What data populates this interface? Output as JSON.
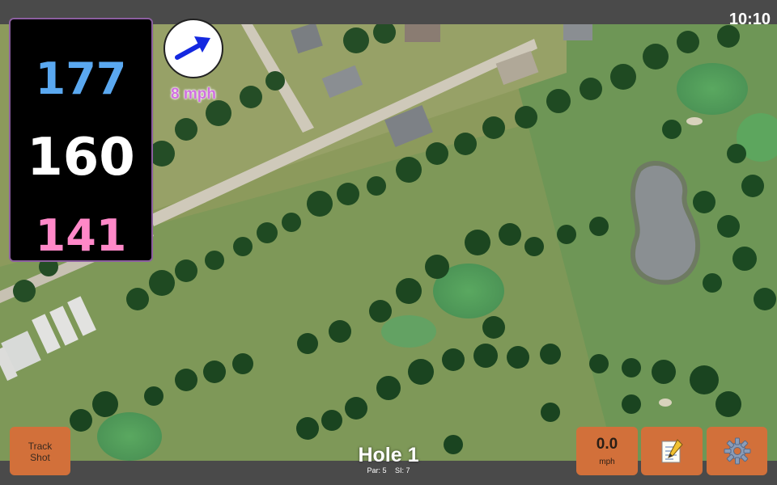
{
  "status_bar": {
    "clock": "10:10"
  },
  "distances": {
    "back": "177",
    "middle": "160",
    "front": "141"
  },
  "wind": {
    "speed_label": "8 mph",
    "direction_icon": "wind-arrow-icon"
  },
  "hole": {
    "title": "Hole 1",
    "par_label": "Par: 5",
    "si_label": "SI: 7"
  },
  "buttons": {
    "track_shot": "Track\nShot",
    "speed_value": "0.0",
    "speed_unit": "mph",
    "notes_icon": "notepad-icon",
    "settings_icon": "gear-icon"
  },
  "colors": {
    "accent_button": "#d2703a",
    "back_distance": "#5aa8f0",
    "middle_distance": "#ffffff",
    "front_distance": "#ff88c8",
    "wind_label": "#d070e0",
    "panel_border": "#8c5fa0"
  }
}
